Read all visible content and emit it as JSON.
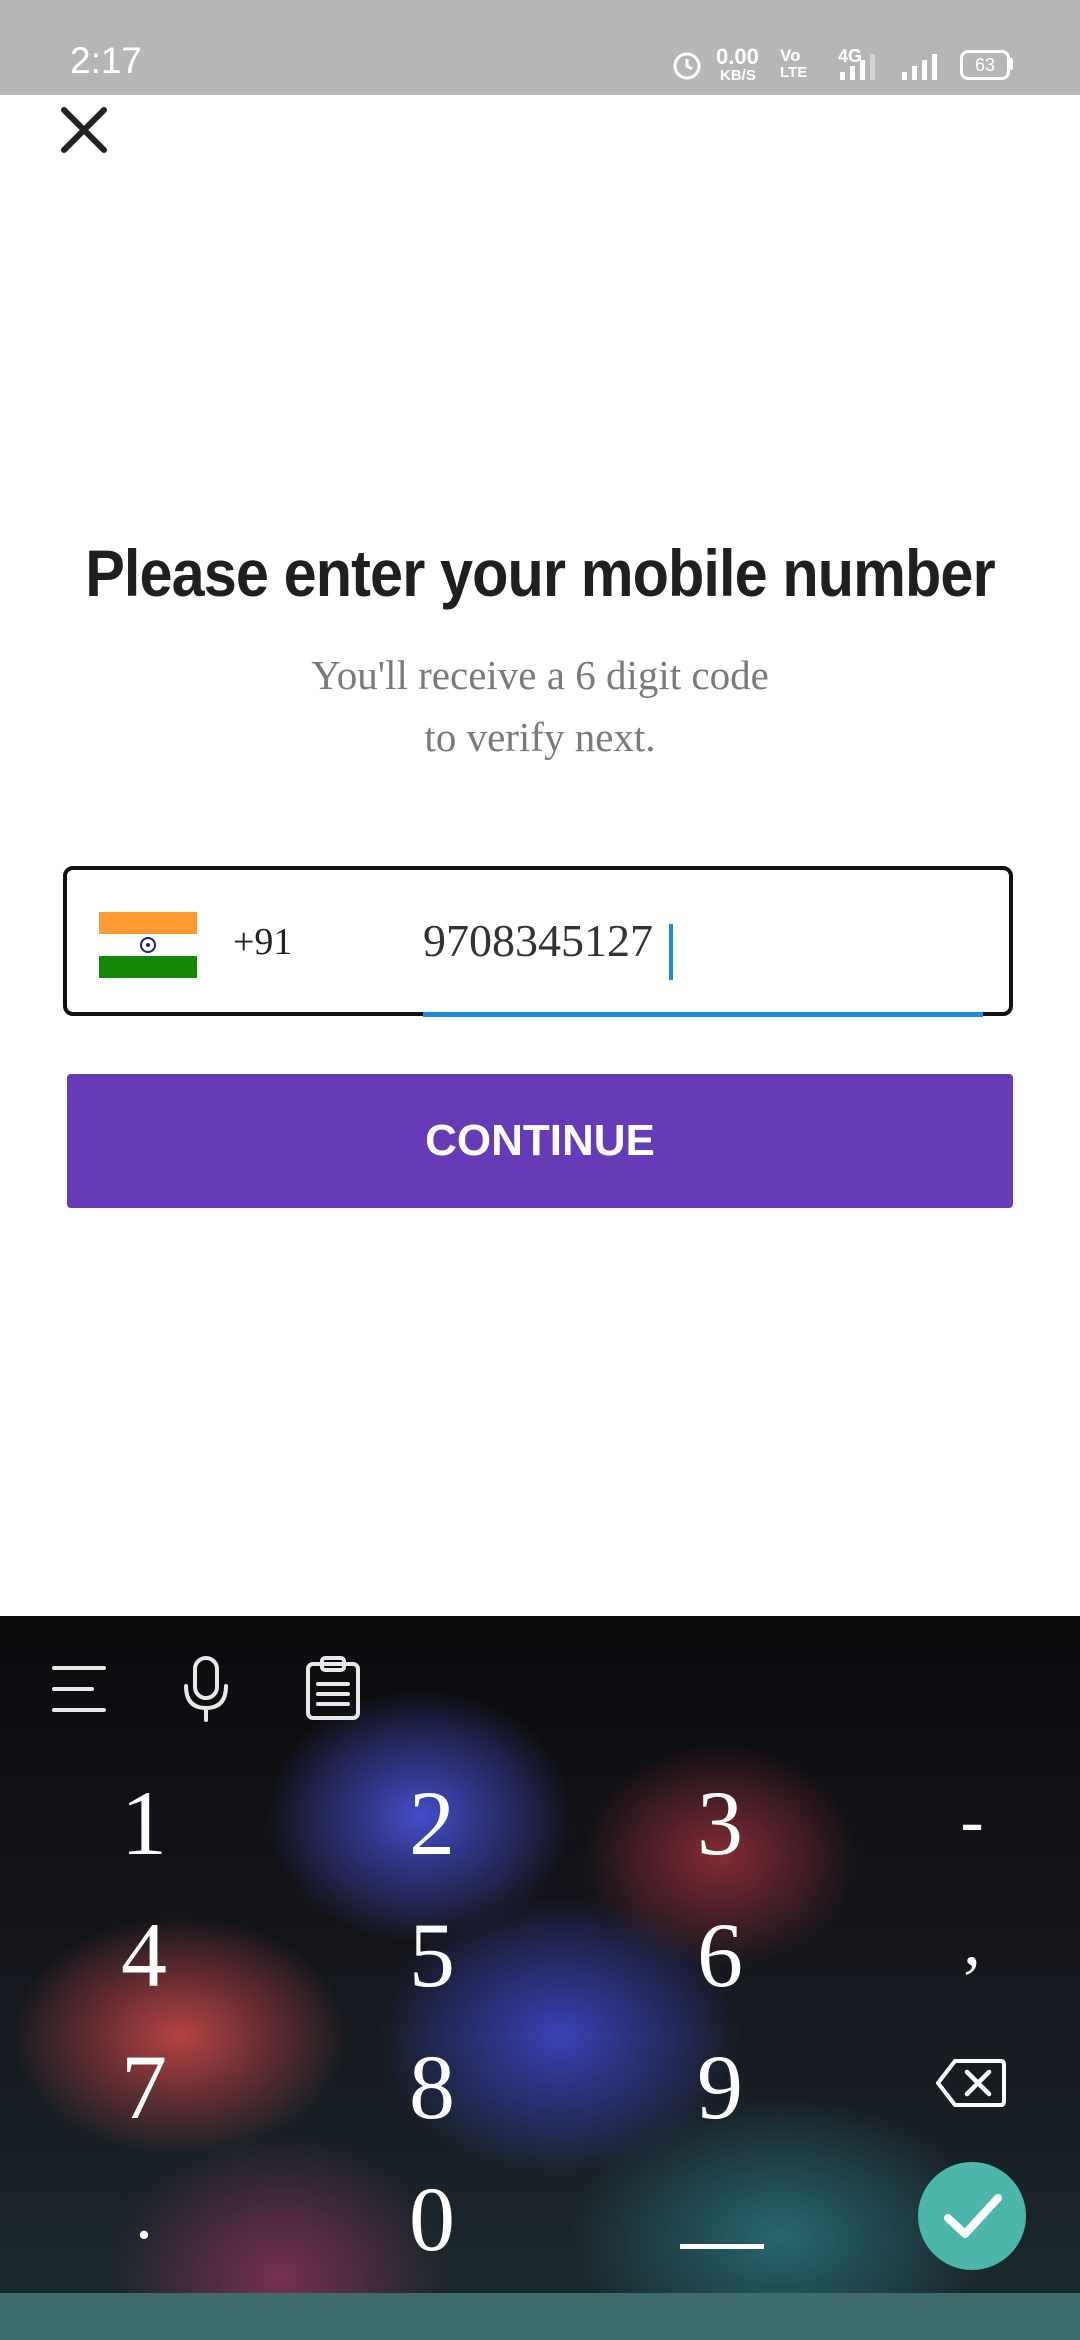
{
  "status_bar": {
    "time": "2:17",
    "speed": "0.00",
    "speed_unit": "KB/S",
    "volte": "Vo",
    "volte2": "LTE",
    "network": "4G",
    "battery": "63"
  },
  "header": {
    "title": "Please enter your mobile number",
    "subtitle_line1": "You'll receive a 6 digit code",
    "subtitle_line2": "to verify next."
  },
  "phone": {
    "country_code": "+91",
    "number": "9708345127",
    "flag_colors": [
      "#ff9933",
      "#ffffff",
      "#138808"
    ]
  },
  "actions": {
    "continue_label": "CONTINUE",
    "accent_color": "#673ab7"
  },
  "keyboard": {
    "rows": [
      [
        "1",
        "2",
        "3",
        "-"
      ],
      [
        "4",
        "5",
        "6",
        ","
      ],
      [
        "7",
        "8",
        "9",
        "backspace"
      ],
      [
        ".",
        "0",
        "_",
        "enter"
      ]
    ],
    "tools": [
      "menu-icon",
      "microphone-icon",
      "clipboard-icon"
    ]
  }
}
